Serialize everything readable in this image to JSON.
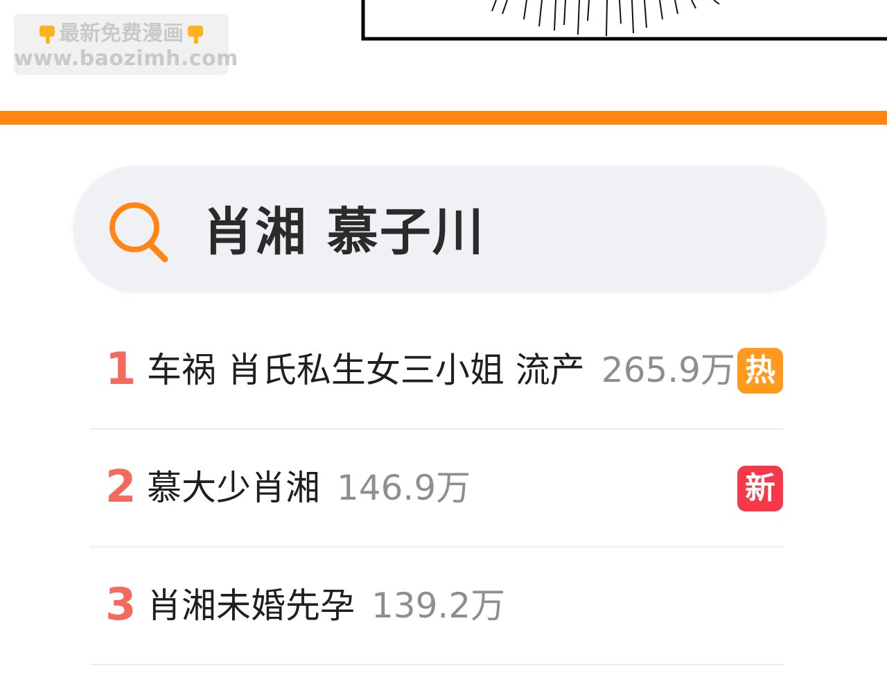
{
  "watermark": {
    "line1": "最新免费漫画",
    "line2": "www.baozimh.com"
  },
  "search": {
    "query": "肖湘 慕子川"
  },
  "trending": [
    {
      "rank": "1",
      "topic": "车祸 肖氏私生女三小姐 流产",
      "count": "265.9万",
      "badge": "热",
      "badge_color": "#ff9a1f"
    },
    {
      "rank": "2",
      "topic": "慕大少肖湘",
      "count": "146.9万",
      "badge": "新",
      "badge_color": "#f5394a"
    },
    {
      "rank": "3",
      "topic": "肖湘未婚先孕",
      "count": "139.2万",
      "badge": null,
      "badge_color": null
    }
  ],
  "colors": {
    "accent_orange": "#ff8614",
    "rank_red": "#f36b5c",
    "search_bg": "#f0f1f5"
  }
}
